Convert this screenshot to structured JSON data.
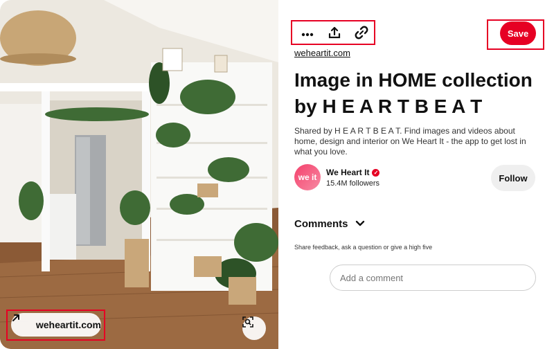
{
  "pin": {
    "source_pill": "weheartit.com",
    "actions": {
      "more": "more-options",
      "share": "share",
      "link": "copy-link"
    },
    "save_label": "Save",
    "source_link": "weheartit.com",
    "title": "Image in HOME collection by H E A R T B E A T",
    "description": "Shared by H E A R T B E A T. Find images and videos about home, design and interior on We Heart It - the app to get lost in what you love."
  },
  "author": {
    "avatar_text": "we it",
    "name": "We Heart It",
    "followers": "15.4M followers",
    "follow_label": "Follow"
  },
  "comments": {
    "heading": "Comments",
    "hint": "Share feedback, ask a question or give a high five",
    "placeholder": "Add a comment"
  },
  "colors": {
    "accent": "#e60023",
    "follow_bg": "#efefef"
  }
}
